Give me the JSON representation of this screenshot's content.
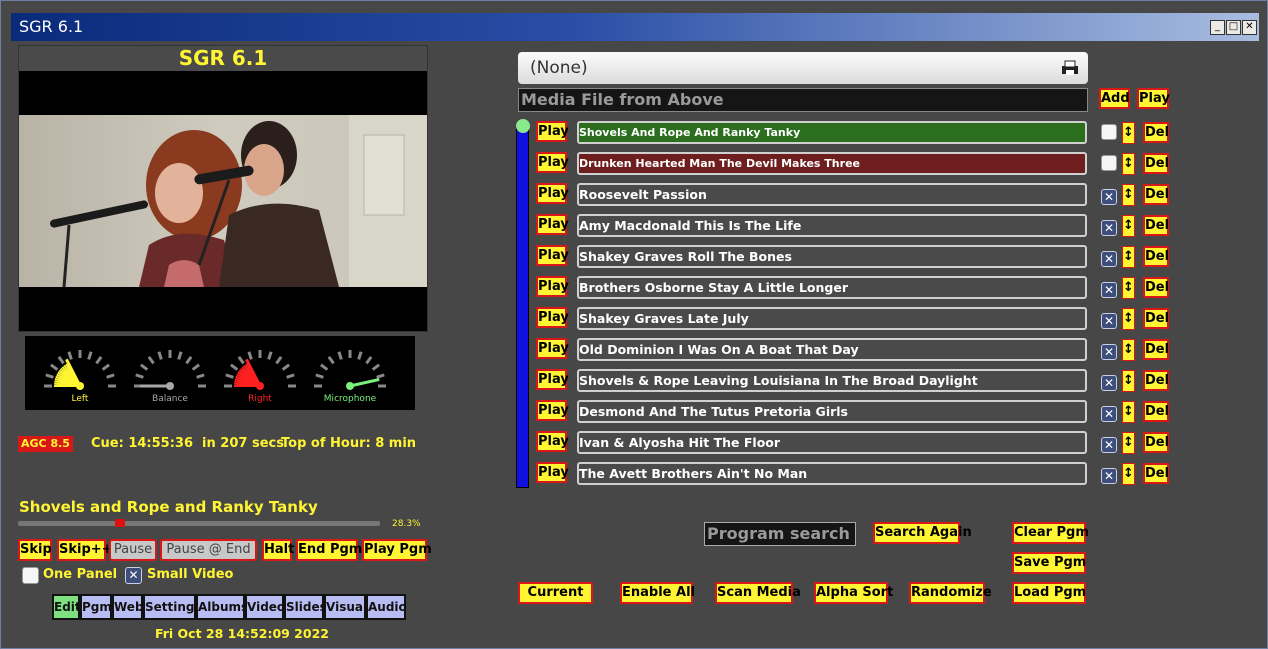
{
  "window": {
    "title": "SGR 6.1"
  },
  "video_panel": {
    "title": "SGR 6.1"
  },
  "meters": [
    {
      "label": "Left",
      "color": "#fff533"
    },
    {
      "label": "Balance",
      "color": "#a8a8a8"
    },
    {
      "label": "Right",
      "color": "#ff2020"
    },
    {
      "label": "Microphone",
      "color": "#7cf07c"
    }
  ],
  "status": {
    "agc": "AGC 8.5",
    "cue": "Cue: 14:55:36  in 207 secs",
    "top_of_hour": "Top of Hour: 8 min"
  },
  "now_playing": {
    "title": "Shovels and Rope and Ranky Tanky",
    "progress_text": "28.3%",
    "progress": 0.283
  },
  "transport": {
    "skip": "Skip",
    "skip_pp": "Skip++",
    "pause": "Pause",
    "pause_at_end": "Pause @ End",
    "halt": "Halt",
    "end_pgm": "End Pgm",
    "play_pgm": "Play Pgm"
  },
  "options": {
    "one_panel": "One Panel",
    "one_panel_checked": false,
    "small_video": "Small Video",
    "small_video_checked": true
  },
  "tabs": [
    "Edit",
    "Pgm",
    "Web",
    "Settings",
    "Albums",
    "Video",
    "Slides",
    "Visual",
    "Audio"
  ],
  "datetime": "Fri Oct 28 14:52:09 2022",
  "media": {
    "dropdown_value": "(None)",
    "file_placeholder": "Media File from Above",
    "add": "Add",
    "play": "Play"
  },
  "playlist": {
    "play_label": "Play",
    "del_label": "Del",
    "arrow_label": "↕",
    "items": [
      {
        "title": "Shovels And Rope And Ranky Tanky",
        "state": "playing",
        "checked": false
      },
      {
        "title": "Drunken Hearted Man The Devil Makes Three",
        "state": "cued",
        "checked": false
      },
      {
        "title": "Roosevelt Passion",
        "state": "",
        "checked": true
      },
      {
        "title": "Amy Macdonald This Is The Life",
        "state": "",
        "checked": true
      },
      {
        "title": "Shakey Graves Roll The Bones",
        "state": "",
        "checked": true
      },
      {
        "title": "Brothers Osborne Stay A Little Longer",
        "state": "",
        "checked": true
      },
      {
        "title": "Shakey Graves Late July",
        "state": "",
        "checked": true
      },
      {
        "title": "Old Dominion I Was On A Boat That Day",
        "state": "",
        "checked": true
      },
      {
        "title": "Shovels & Rope Leaving Louisiana In The Broad Daylight",
        "state": "",
        "checked": true
      },
      {
        "title": "Desmond And The Tutus Pretoria Girls",
        "state": "",
        "checked": true
      },
      {
        "title": "Ivan & Alyosha Hit The Floor",
        "state": "",
        "checked": true
      },
      {
        "title": "The Avett Brothers Ain't No Man",
        "state": "",
        "checked": true
      }
    ]
  },
  "search": {
    "placeholder": "Program search",
    "search_again": "Search Again"
  },
  "program": {
    "clear": "Clear Pgm",
    "save": "Save Pgm",
    "load": "Load Pgm"
  },
  "bottom_actions": {
    "current": "Current",
    "enable_all": "Enable All",
    "scan_media": "Scan Media",
    "alpha_sort": "Alpha Sort",
    "randomize": "Randomize"
  },
  "colors": {
    "accent_yellow": "#fff533",
    "button_border": "#d81818",
    "playing_row": "#2a6e1e",
    "cued_row": "#6e1e1e",
    "scroll_blue": "#1010e0"
  }
}
